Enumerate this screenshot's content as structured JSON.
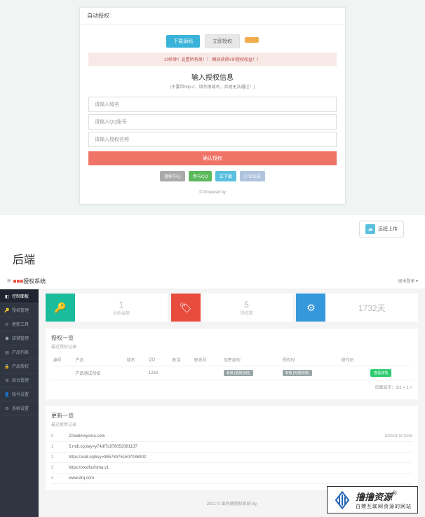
{
  "top": {
    "card_title": "自动授权",
    "btns": [
      "下载源码",
      "立即授权",
      ""
    ],
    "notice": "10秒钟！处置所有烦！！ 瞬间获得VIP授权权益！！",
    "form_title": "输入授权信息",
    "form_sub": "(不要带http://，填写根域名，否则无法通过！)",
    "inputs": [
      "请输入域名",
      "请输入QQ账号",
      "请输入授权名称"
    ],
    "submit": "确认授权",
    "foot_btns": [
      "授权中心",
      "参与QQ",
      "正下载",
      "少许公告"
    ],
    "powered": "© Powered by"
  },
  "upload": {
    "label": "远程上传"
  },
  "section2_title": "后端",
  "admin": {
    "brand_a": "■■■",
    "brand_b": "授权系统",
    "top_right": "退出登录 ▾",
    "sidebar": [
      "控制面板",
      "授权管理",
      "更新工具",
      "店铺管理",
      "产品列表",
      "产品授权",
      "后台管理",
      "账号设置",
      "系统设置"
    ],
    "stats": [
      {
        "num": "1",
        "lbl": "总收益额"
      },
      {
        "num": "",
        "lbl": ""
      },
      {
        "num": "5",
        "lbl": "授权数"
      },
      {
        "num": "",
        "lbl": ""
      },
      {
        "num": "1732天",
        "lbl": ""
      }
    ],
    "panel1": {
      "title": "授权一览",
      "sub": "最近授权记录"
    },
    "tbl": {
      "head": [
        "编号",
        "产品",
        "域名",
        "QQ",
        "账连",
        "联系号",
        "加密类别",
        "授权时",
        "操作员",
        ""
      ],
      "row": [
        "",
        "产品测试勿拍",
        "",
        "1234",
        "",
        "",
        "有效 [更新授权]",
        "有效 [无限权限]",
        "",
        ""
      ],
      "btn": "查看详情"
    },
    "pager": "页面显示：1/1  <  1  >",
    "panel2": {
      "title": "更新一览",
      "sub": "最近更新记录"
    },
    "domains": [
      {
        "id": "0",
        "txt": "Zmwbmxycma.com",
        "date": "2020-01-16 23:55"
      },
      {
        "id": "1",
        "txt": "5.mdl.cq.key=y74df7c878052081137",
        "date": ""
      },
      {
        "id": "2",
        "txt": "https://xa8.cq/key=985784751607036902",
        "date": ""
      },
      {
        "id": "3",
        "txt": "https://xxxifushima.v1",
        "date": ""
      },
      {
        "id": "4",
        "txt": "www.drq.com",
        "date": ""
      }
    ],
    "copyright": "2021 © 巫阿德授权系统 By"
  },
  "watermark": {
    "main": "撸撸资源",
    "sup": "®",
    "sub": "白嫖互联网资源的网站"
  }
}
